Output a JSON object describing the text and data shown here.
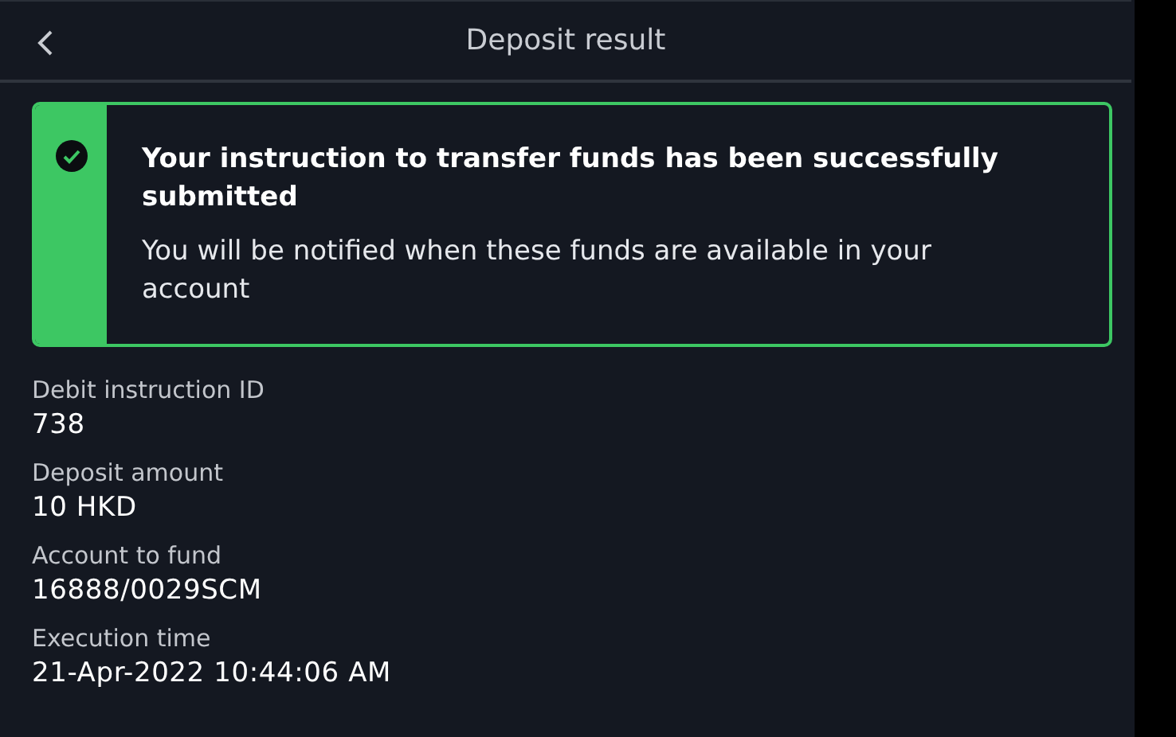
{
  "header": {
    "title": "Deposit result"
  },
  "notice": {
    "title": "Your instruction to transfer funds has been successfully submitted",
    "message": "You will be notified when these funds are available in your account"
  },
  "details": [
    {
      "label": "Debit instruction ID",
      "value": "738"
    },
    {
      "label": "Deposit amount",
      "value": "10 HKD"
    },
    {
      "label": "Account to fund",
      "value": "16888/0029SCM"
    },
    {
      "label": "Execution time",
      "value": "21-Apr-2022 10:44:06 AM"
    }
  ]
}
